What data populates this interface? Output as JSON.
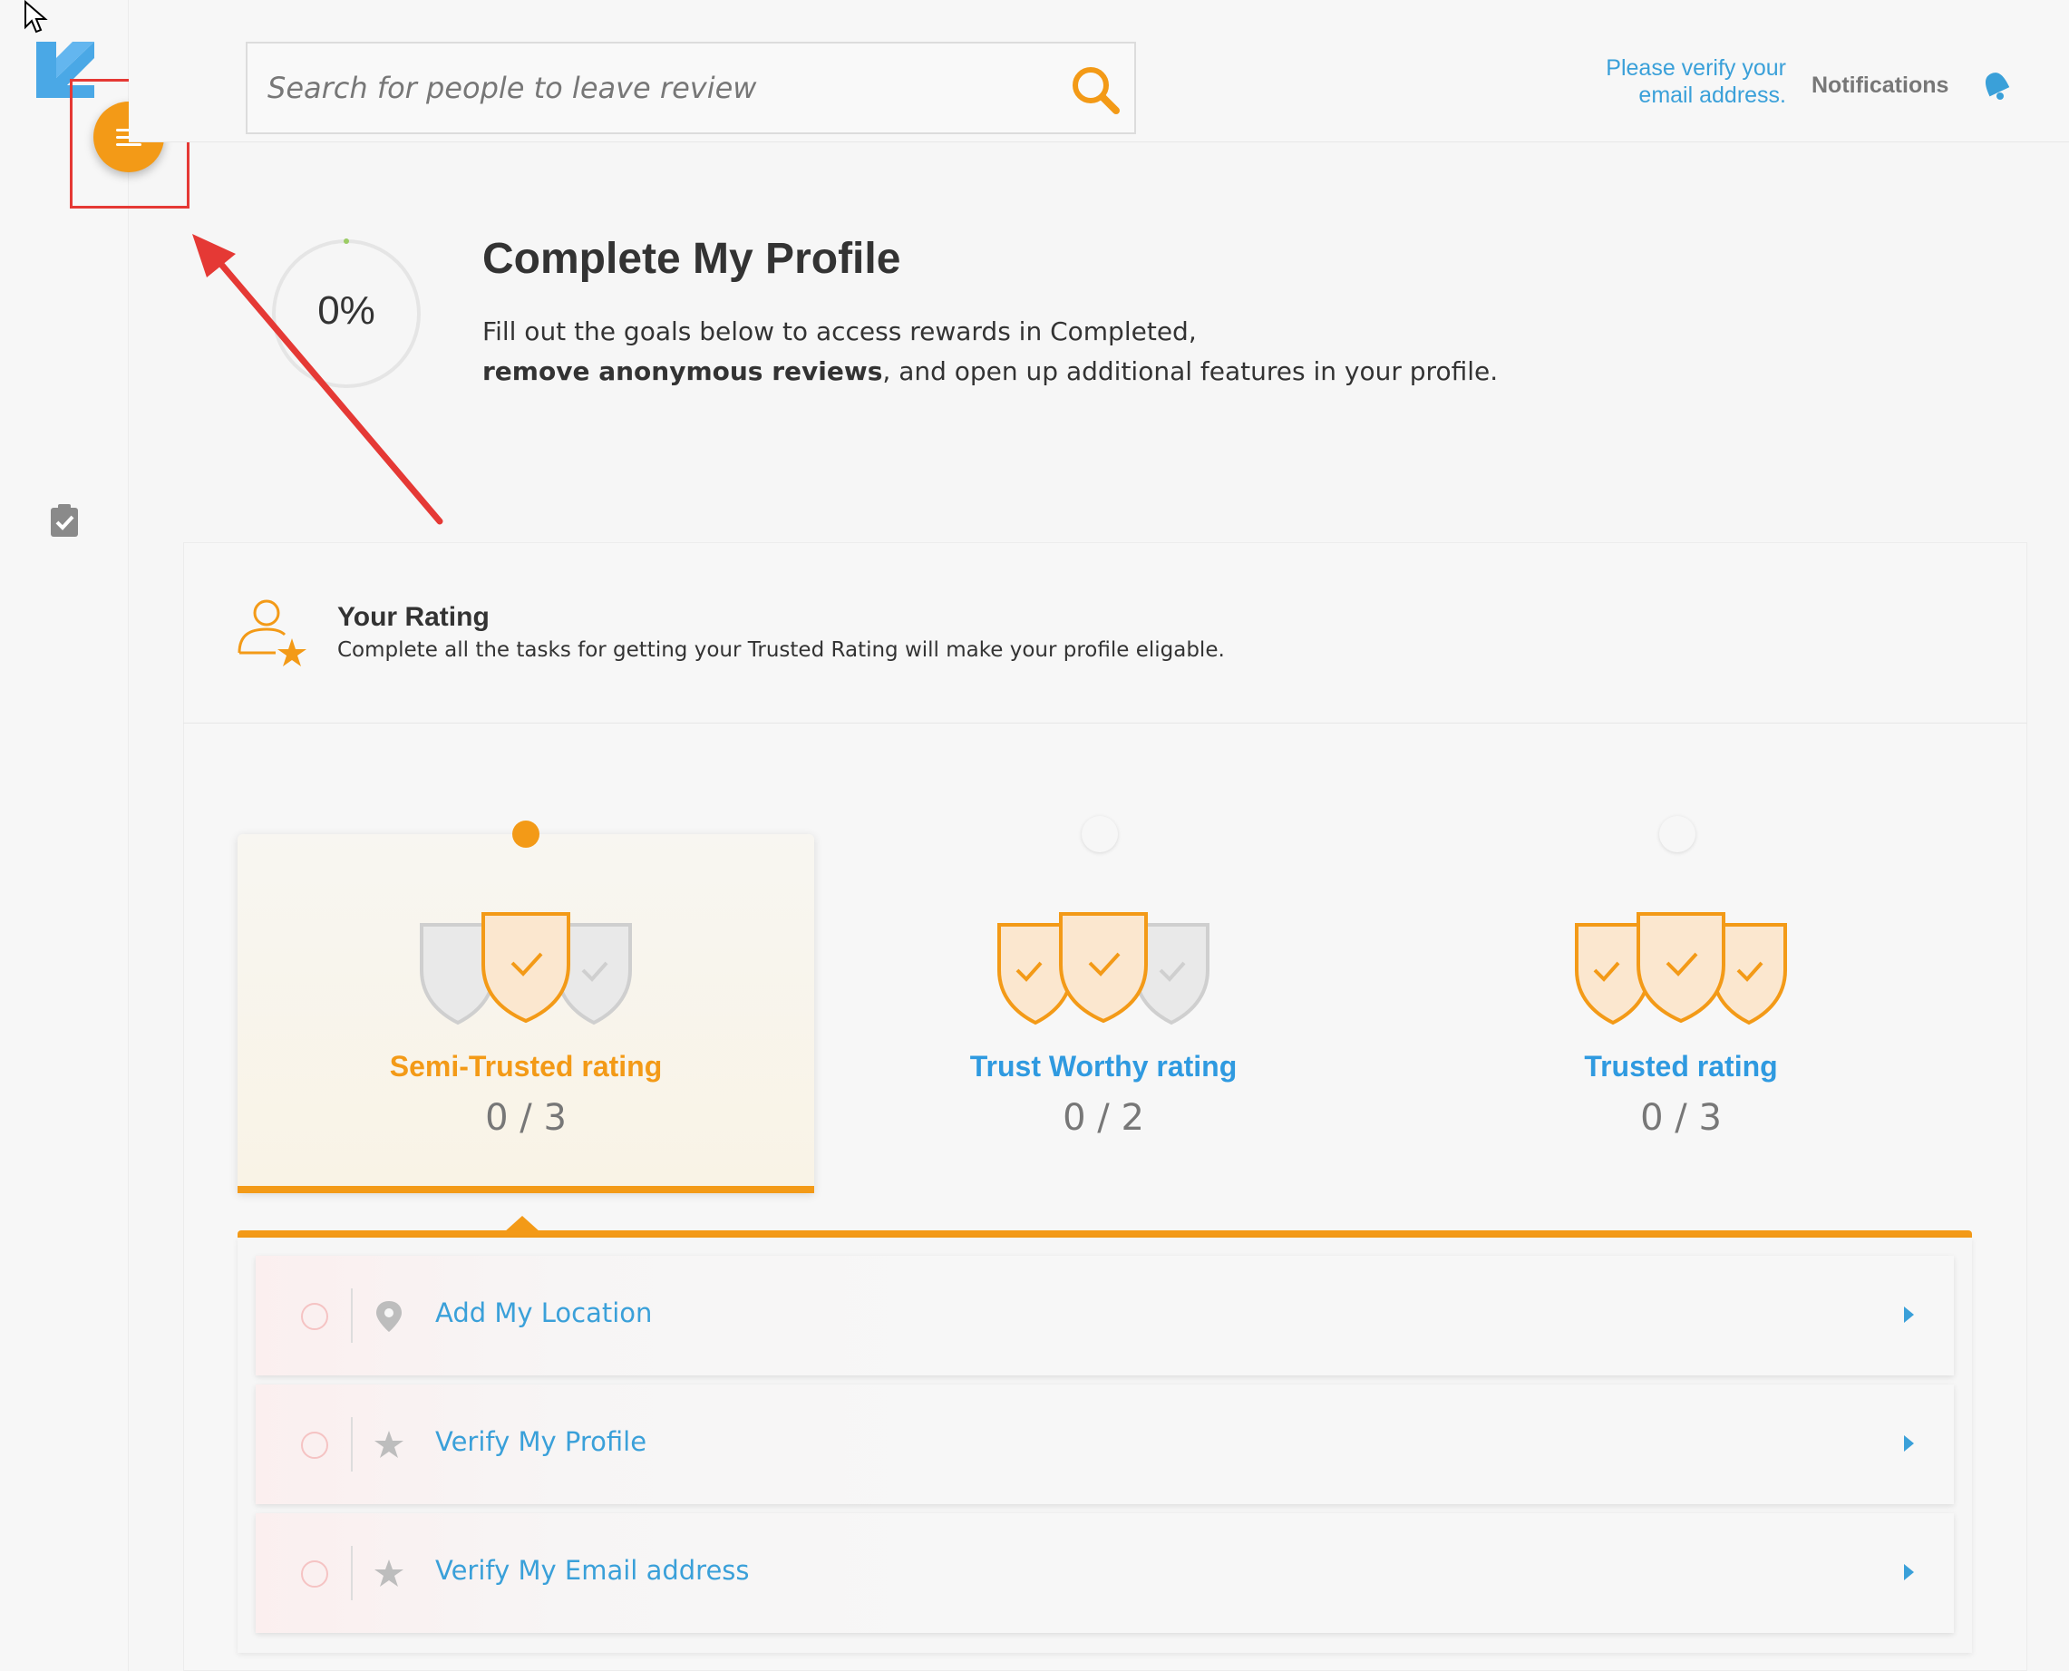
{
  "header": {
    "search_placeholder": "Search for people to leave review",
    "verify_email_text": "Please verify your email address.",
    "notifications_label": "Notifications"
  },
  "profile": {
    "progress_percent": "0%",
    "progress_value": 0,
    "title": "Complete My Profile",
    "desc_line1": "Fill out the goals below to access rewards in Completed,",
    "desc_bold": "remove anonymous reviews",
    "desc_rest": ", and open up additional features in your profile."
  },
  "rating": {
    "title": "Your Rating",
    "subtitle": "Complete all the tasks for getting your Trusted Rating will make your profile eligable.",
    "tiers": [
      {
        "name": "Semi-Trusted rating",
        "count": "0 / 3",
        "color": "#f39a17",
        "active": true
      },
      {
        "name": "Trust Worthy rating",
        "count": "0 / 2",
        "color": "#2f9ae0",
        "active": false
      },
      {
        "name": "Trusted rating",
        "count": "0 / 3",
        "color": "#2f9ae0",
        "active": false
      }
    ]
  },
  "tasks": [
    {
      "label": "Add My Location",
      "icon": "location-pin-icon"
    },
    {
      "label": "Verify My Profile",
      "icon": "star-icon"
    },
    {
      "label": "Verify My Email address",
      "icon": "star-icon"
    }
  ],
  "colors": {
    "accent": "#f39a17",
    "link": "#3aa0d9",
    "highlight": "#e53935"
  }
}
